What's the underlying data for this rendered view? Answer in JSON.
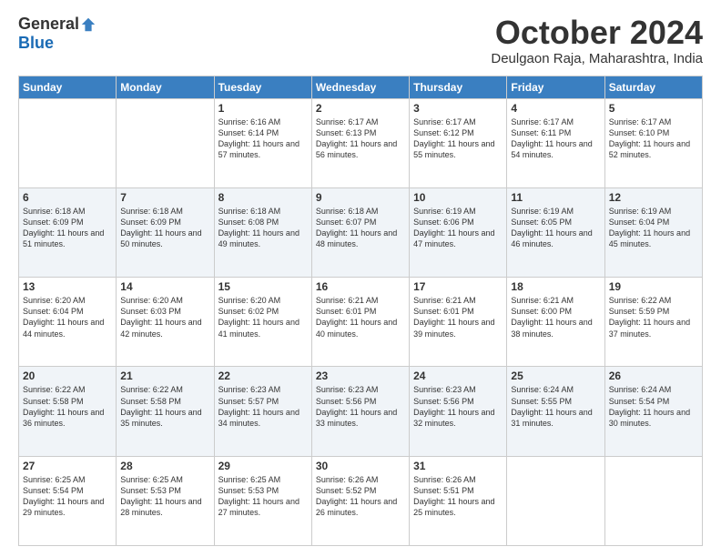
{
  "logo": {
    "general": "General",
    "blue": "Blue"
  },
  "title": "October 2024",
  "location": "Deulgaon Raja, Maharashtra, India",
  "days_of_week": [
    "Sunday",
    "Monday",
    "Tuesday",
    "Wednesday",
    "Thursday",
    "Friday",
    "Saturday"
  ],
  "weeks": [
    [
      {
        "day": "",
        "info": ""
      },
      {
        "day": "",
        "info": ""
      },
      {
        "day": "1",
        "info": "Sunrise: 6:16 AM\nSunset: 6:14 PM\nDaylight: 11 hours and 57 minutes."
      },
      {
        "day": "2",
        "info": "Sunrise: 6:17 AM\nSunset: 6:13 PM\nDaylight: 11 hours and 56 minutes."
      },
      {
        "day": "3",
        "info": "Sunrise: 6:17 AM\nSunset: 6:12 PM\nDaylight: 11 hours and 55 minutes."
      },
      {
        "day": "4",
        "info": "Sunrise: 6:17 AM\nSunset: 6:11 PM\nDaylight: 11 hours and 54 minutes."
      },
      {
        "day": "5",
        "info": "Sunrise: 6:17 AM\nSunset: 6:10 PM\nDaylight: 11 hours and 52 minutes."
      }
    ],
    [
      {
        "day": "6",
        "info": "Sunrise: 6:18 AM\nSunset: 6:09 PM\nDaylight: 11 hours and 51 minutes."
      },
      {
        "day": "7",
        "info": "Sunrise: 6:18 AM\nSunset: 6:09 PM\nDaylight: 11 hours and 50 minutes."
      },
      {
        "day": "8",
        "info": "Sunrise: 6:18 AM\nSunset: 6:08 PM\nDaylight: 11 hours and 49 minutes."
      },
      {
        "day": "9",
        "info": "Sunrise: 6:18 AM\nSunset: 6:07 PM\nDaylight: 11 hours and 48 minutes."
      },
      {
        "day": "10",
        "info": "Sunrise: 6:19 AM\nSunset: 6:06 PM\nDaylight: 11 hours and 47 minutes."
      },
      {
        "day": "11",
        "info": "Sunrise: 6:19 AM\nSunset: 6:05 PM\nDaylight: 11 hours and 46 minutes."
      },
      {
        "day": "12",
        "info": "Sunrise: 6:19 AM\nSunset: 6:04 PM\nDaylight: 11 hours and 45 minutes."
      }
    ],
    [
      {
        "day": "13",
        "info": "Sunrise: 6:20 AM\nSunset: 6:04 PM\nDaylight: 11 hours and 44 minutes."
      },
      {
        "day": "14",
        "info": "Sunrise: 6:20 AM\nSunset: 6:03 PM\nDaylight: 11 hours and 42 minutes."
      },
      {
        "day": "15",
        "info": "Sunrise: 6:20 AM\nSunset: 6:02 PM\nDaylight: 11 hours and 41 minutes."
      },
      {
        "day": "16",
        "info": "Sunrise: 6:21 AM\nSunset: 6:01 PM\nDaylight: 11 hours and 40 minutes."
      },
      {
        "day": "17",
        "info": "Sunrise: 6:21 AM\nSunset: 6:01 PM\nDaylight: 11 hours and 39 minutes."
      },
      {
        "day": "18",
        "info": "Sunrise: 6:21 AM\nSunset: 6:00 PM\nDaylight: 11 hours and 38 minutes."
      },
      {
        "day": "19",
        "info": "Sunrise: 6:22 AM\nSunset: 5:59 PM\nDaylight: 11 hours and 37 minutes."
      }
    ],
    [
      {
        "day": "20",
        "info": "Sunrise: 6:22 AM\nSunset: 5:58 PM\nDaylight: 11 hours and 36 minutes."
      },
      {
        "day": "21",
        "info": "Sunrise: 6:22 AM\nSunset: 5:58 PM\nDaylight: 11 hours and 35 minutes."
      },
      {
        "day": "22",
        "info": "Sunrise: 6:23 AM\nSunset: 5:57 PM\nDaylight: 11 hours and 34 minutes."
      },
      {
        "day": "23",
        "info": "Sunrise: 6:23 AM\nSunset: 5:56 PM\nDaylight: 11 hours and 33 minutes."
      },
      {
        "day": "24",
        "info": "Sunrise: 6:23 AM\nSunset: 5:56 PM\nDaylight: 11 hours and 32 minutes."
      },
      {
        "day": "25",
        "info": "Sunrise: 6:24 AM\nSunset: 5:55 PM\nDaylight: 11 hours and 31 minutes."
      },
      {
        "day": "26",
        "info": "Sunrise: 6:24 AM\nSunset: 5:54 PM\nDaylight: 11 hours and 30 minutes."
      }
    ],
    [
      {
        "day": "27",
        "info": "Sunrise: 6:25 AM\nSunset: 5:54 PM\nDaylight: 11 hours and 29 minutes."
      },
      {
        "day": "28",
        "info": "Sunrise: 6:25 AM\nSunset: 5:53 PM\nDaylight: 11 hours and 28 minutes."
      },
      {
        "day": "29",
        "info": "Sunrise: 6:25 AM\nSunset: 5:53 PM\nDaylight: 11 hours and 27 minutes."
      },
      {
        "day": "30",
        "info": "Sunrise: 6:26 AM\nSunset: 5:52 PM\nDaylight: 11 hours and 26 minutes."
      },
      {
        "day": "31",
        "info": "Sunrise: 6:26 AM\nSunset: 5:51 PM\nDaylight: 11 hours and 25 minutes."
      },
      {
        "day": "",
        "info": ""
      },
      {
        "day": "",
        "info": ""
      }
    ]
  ]
}
